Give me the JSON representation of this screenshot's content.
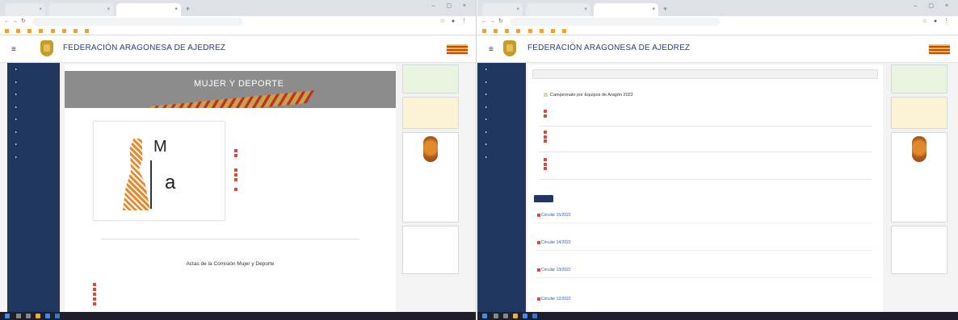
{
  "left": {
    "tabs": [
      "",
      "",
      ""
    ],
    "url": "",
    "site_title": "FEDERACIÓN ARAGONESA DE AJEDREZ",
    "sidebar": [
      "",
      "",
      "",
      "",
      "",
      "",
      "",
      ""
    ],
    "banner_title": "MUJER Y DEPORTE",
    "banner_subtitle": "",
    "logo_letters": {
      "m": "M",
      "a": "a"
    },
    "actas_heading": "Actas de la Comisión Mujer y Deporte",
    "right": {
      "box1": "",
      "box2": "",
      "box3": "",
      "box4": ""
    }
  },
  "right_screen": {
    "tabs": [
      "",
      "",
      ""
    ],
    "url": "",
    "site_title": "FEDERACIÓN ARAGONESA DE AJEDREZ",
    "sidebar": [
      "",
      "",
      "",
      "",
      "",
      "",
      "",
      ""
    ],
    "breadcrumb": "",
    "championship_title": "Campeonato por Equipos de Aragón 2022",
    "content_tabs": [
      "",
      "",
      "",
      ""
    ],
    "news": [
      {
        "title": "Circular 15/2022",
        "date": "",
        "summary": ""
      },
      {
        "title": "Circular 14/2022",
        "date": "",
        "summary": ""
      },
      {
        "title": "Circular 13/2022",
        "date": "",
        "summary": ""
      },
      {
        "title": "Circular 12/2022",
        "date": "",
        "summary": ""
      }
    ],
    "right": {
      "box1": "",
      "box2": "",
      "box3": "",
      "box4": ""
    }
  },
  "colors": {
    "sidebar": "#22375f",
    "title": "#2a3f73",
    "link": "#2f5cb0",
    "banner": "#8c8c8c"
  }
}
